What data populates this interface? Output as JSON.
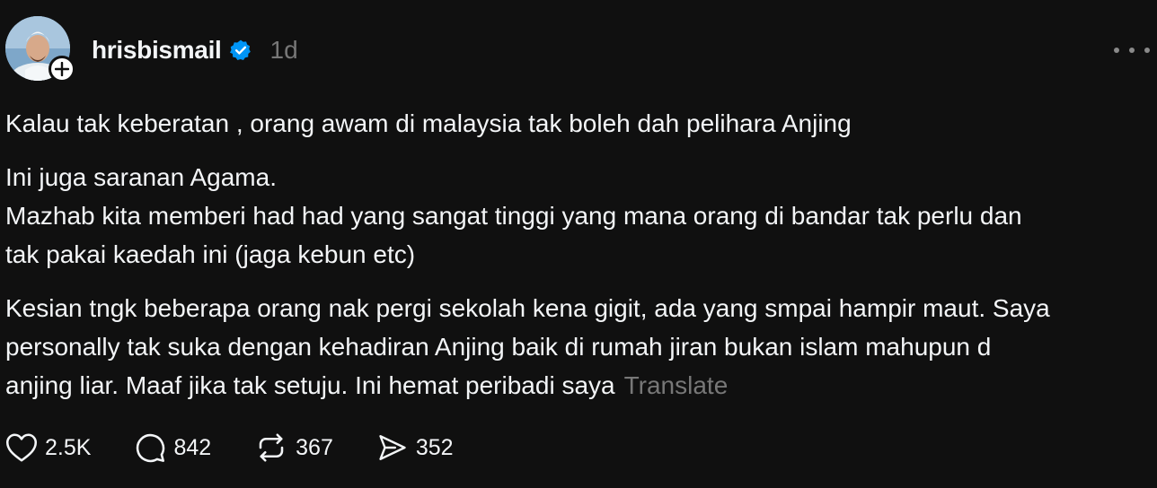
{
  "post": {
    "username": "hrisbismail",
    "timestamp": "1d",
    "paragraphs": [
      [
        "Kalau tak keberatan , orang awam di malaysia tak boleh dah pelihara Anjing"
      ],
      [
        "Ini juga saranan Agama.",
        "Mazhab kita memberi had had yang sangat tinggi yang mana orang di bandar tak perlu dan",
        "tak pakai kaedah ini (jaga kebun etc)"
      ],
      [
        "Kesian tngk beberapa orang nak pergi sekolah kena gigit, ada yang smpai hampir maut. Saya",
        "personally tak suka dengan kehadiran Anjing baik di rumah jiran bukan islam mahupun d",
        "anjing liar. Maaf jika tak setuju. Ini hemat peribadi saya"
      ]
    ],
    "translate_label": "Translate"
  },
  "actions": {
    "likes": "2.5K",
    "replies": "842",
    "reposts": "367",
    "shares": "352"
  },
  "icons": {
    "verified": "verified-badge-icon",
    "follow": "plus-icon",
    "more": "more-options-icon",
    "like": "heart-icon",
    "reply": "comment-icon",
    "repost": "repost-icon",
    "share": "send-icon"
  },
  "colors": {
    "background": "#101010",
    "text": "#f3f5f7",
    "muted": "#777777",
    "verified": "#0095f6"
  }
}
